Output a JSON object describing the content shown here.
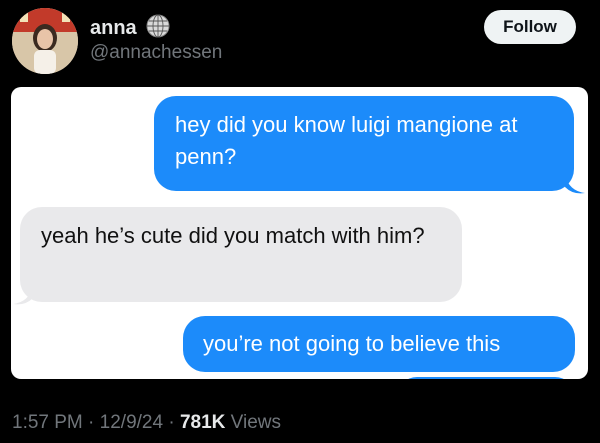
{
  "profile": {
    "display_name": "anna",
    "handle": "@annachessen",
    "follow_label": "Follow"
  },
  "messages": [
    {
      "direction": "sent",
      "text": "hey did you know luigi mangione at penn?"
    },
    {
      "direction": "received",
      "text": "yeah he’s cute did you match with him?"
    },
    {
      "direction": "sent",
      "text": "you’re not going to believe this"
    }
  ],
  "meta": {
    "time": "1:57 PM",
    "separator": " · ",
    "date": "12/9/24",
    "views_count": "781K",
    "views_label": "Views"
  },
  "colors": {
    "sent_bubble": "#1c8bfa",
    "received_bubble": "#e9e9eb",
    "background": "#000000"
  },
  "icons": {
    "verified_badge": "globe-icon"
  }
}
